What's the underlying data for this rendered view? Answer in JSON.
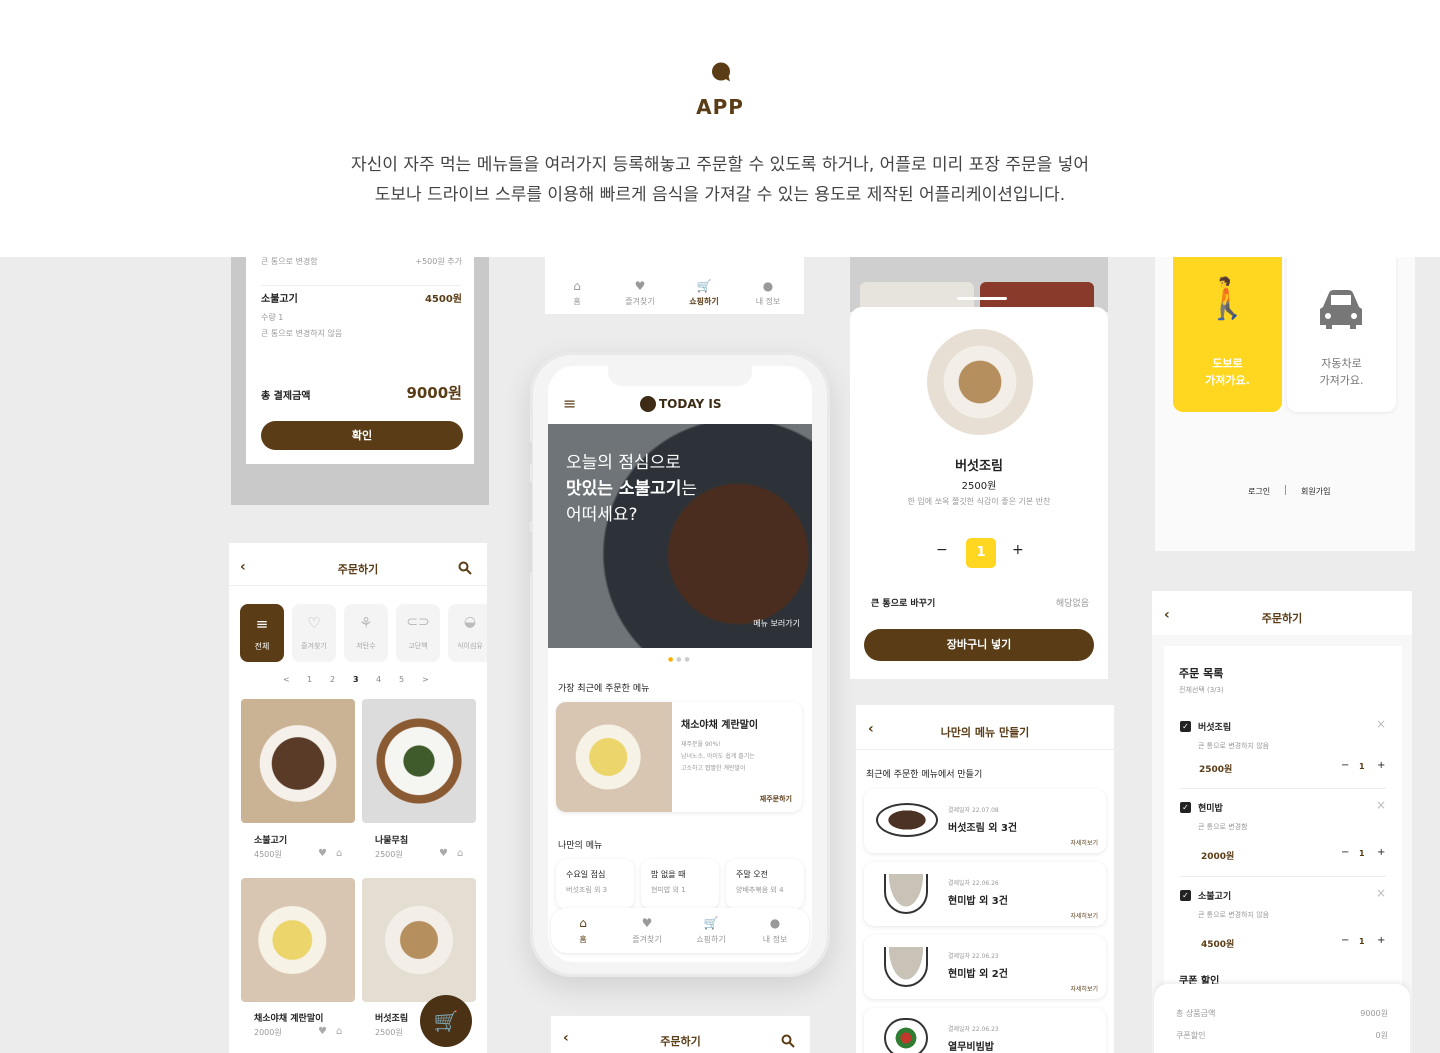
{
  "header": {
    "title": "APP",
    "desc_line1": "자신이 자주 먹는 메뉴들을 여러가지 등록해놓고 주문할 수 있도록 하거나, 어플로 미리 포장 주문을 넣어",
    "desc_line2": "도보나 드라이브 스루를 이용해 빠르게 음식을 가져갈 수 있는 용도로 제작된 어플리케이션입니다."
  },
  "confirm_card": {
    "opt1": "큰 통으로 변경함",
    "opt1_price": "+500원 추가",
    "item": "소불고기",
    "item_price": "4500원",
    "qty": "수량 1",
    "opt2": "큰 통으로 변경하지 않음",
    "total_label": "총 결제금액",
    "total": "9000원",
    "button": "확인"
  },
  "order_card": {
    "title": "주문하기",
    "categories": [
      "전체",
      "즐겨찾기",
      "저탄수",
      "고단백",
      "식이섬유"
    ],
    "pages": [
      "<",
      "1",
      "2",
      "3",
      "4",
      "5",
      ">"
    ],
    "items": [
      {
        "name": "소불고기",
        "price": "4500원"
      },
      {
        "name": "나물무침",
        "price": "2500원"
      },
      {
        "name": "채소야채 계란말이",
        "price": "2000원"
      },
      {
        "name": "버섯조림",
        "price": "2500원"
      }
    ]
  },
  "top_tabbar": {
    "tabs": [
      "홈",
      "즐겨찾기",
      "쇼핑하기",
      "내 정보"
    ]
  },
  "phone": {
    "brand": "TODAY IS",
    "hero_l1": "오늘의 점심으로",
    "hero_l2a": "맛있는 소불고기",
    "hero_l2b": "는",
    "hero_l3": "어떠세요?",
    "hero_link": "메뉴 보러가기",
    "recent_title": "가장 최근에 주문한 메뉴",
    "recent_name": "채소야채 계란말이",
    "recent_rate": "재주문율 90%!",
    "recent_desc1": "남녀노소, 아이도 쉽게 즐기는",
    "recent_desc2": "고소하고 짭짤한 계란말이",
    "recent_btn": "재주문하기",
    "my_title": "나만의 메뉴",
    "my_menus": [
      {
        "title": "수요일 점심",
        "sub": "버섯조림 외 3"
      },
      {
        "title": "밥 없을 때",
        "sub": "현미밥 외 1"
      },
      {
        "title": "주말 오전",
        "sub": "양배추볶음 외 4"
      }
    ],
    "tabs": [
      "홈",
      "즐겨찾기",
      "쇼핑하기",
      "내 정보"
    ]
  },
  "detail_card": {
    "name": "버섯조림",
    "price": "2500원",
    "desc": "한 입에 쏘옥 쫄깃한 식감이 좋은 기본 반찬",
    "qty": "1",
    "minus": "−",
    "plus": "+",
    "opt_label": "큰 통으로 바꾸기",
    "opt_value": "해당없음",
    "button": "장바구니 넣기"
  },
  "mymenu_card": {
    "title": "나만의 메뉴 만들기",
    "sub": "최근에 주문한 메뉴에서 만들기",
    "rows": [
      {
        "date": "결제일자 22.07.08",
        "name": "버섯조림 외 3건",
        "link": "자세히보기"
      },
      {
        "date": "결제일자 22.06.26",
        "name": "현미밥 외 3건",
        "link": "자세히보기"
      },
      {
        "date": "결제일자 22.06.23",
        "name": "현미밥 외 2건",
        "link": "자세히보기"
      },
      {
        "date": "결제일자 22.06.23",
        "name": "열무비빔밥",
        "link": ""
      }
    ]
  },
  "pickup_card": {
    "walk_l1": "도보로",
    "walk_l2": "가져가요.",
    "car_l1": "자동차로",
    "car_l2": "가져가요.",
    "login": "로그인",
    "signup": "회원가입"
  },
  "cart_card": {
    "title": "주문하기",
    "list_title": "주문 목록",
    "select_all": "전체선택 (3/3)",
    "items": [
      {
        "name": "버섯조림",
        "opt": "큰 통으로 변경하지 않음",
        "price": "2500원",
        "qty": "1"
      },
      {
        "name": "현미밥",
        "opt": "큰 통으로 변경함",
        "price": "2000원",
        "qty": "1"
      },
      {
        "name": "소불고기",
        "opt": "큰 통으로 변경하지 않음",
        "price": "4500원",
        "qty": "1"
      }
    ],
    "coupon": "쿠폰 할인",
    "sum_label": "총 상품금액",
    "sum": "9000원",
    "coupon_label": "쿠폰할인",
    "coupon_val": "0원"
  },
  "bottom_card": {
    "title": "주문하기"
  },
  "colors": {
    "brown": "#5a3d17",
    "yellow": "#ffd620",
    "bg": "#ececec"
  }
}
